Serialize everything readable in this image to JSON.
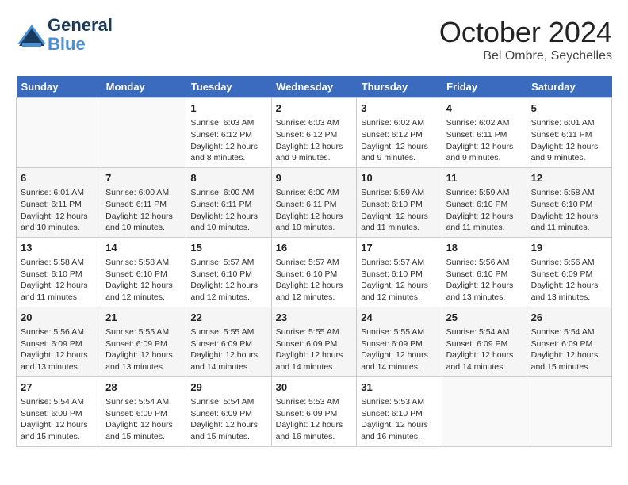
{
  "logo": {
    "line1": "General",
    "line2": "Blue"
  },
  "title": "October 2024",
  "location": "Bel Ombre, Seychelles",
  "days_of_week": [
    "Sunday",
    "Monday",
    "Tuesday",
    "Wednesday",
    "Thursday",
    "Friday",
    "Saturday"
  ],
  "weeks": [
    [
      {
        "day": "",
        "info": ""
      },
      {
        "day": "",
        "info": ""
      },
      {
        "day": "1",
        "info": "Sunrise: 6:03 AM\nSunset: 6:12 PM\nDaylight: 12 hours and 8 minutes."
      },
      {
        "day": "2",
        "info": "Sunrise: 6:03 AM\nSunset: 6:12 PM\nDaylight: 12 hours and 9 minutes."
      },
      {
        "day": "3",
        "info": "Sunrise: 6:02 AM\nSunset: 6:12 PM\nDaylight: 12 hours and 9 minutes."
      },
      {
        "day": "4",
        "info": "Sunrise: 6:02 AM\nSunset: 6:11 PM\nDaylight: 12 hours and 9 minutes."
      },
      {
        "day": "5",
        "info": "Sunrise: 6:01 AM\nSunset: 6:11 PM\nDaylight: 12 hours and 9 minutes."
      }
    ],
    [
      {
        "day": "6",
        "info": "Sunrise: 6:01 AM\nSunset: 6:11 PM\nDaylight: 12 hours and 10 minutes."
      },
      {
        "day": "7",
        "info": "Sunrise: 6:00 AM\nSunset: 6:11 PM\nDaylight: 12 hours and 10 minutes."
      },
      {
        "day": "8",
        "info": "Sunrise: 6:00 AM\nSunset: 6:11 PM\nDaylight: 12 hours and 10 minutes."
      },
      {
        "day": "9",
        "info": "Sunrise: 6:00 AM\nSunset: 6:11 PM\nDaylight: 12 hours and 10 minutes."
      },
      {
        "day": "10",
        "info": "Sunrise: 5:59 AM\nSunset: 6:10 PM\nDaylight: 12 hours and 11 minutes."
      },
      {
        "day": "11",
        "info": "Sunrise: 5:59 AM\nSunset: 6:10 PM\nDaylight: 12 hours and 11 minutes."
      },
      {
        "day": "12",
        "info": "Sunrise: 5:58 AM\nSunset: 6:10 PM\nDaylight: 12 hours and 11 minutes."
      }
    ],
    [
      {
        "day": "13",
        "info": "Sunrise: 5:58 AM\nSunset: 6:10 PM\nDaylight: 12 hours and 11 minutes."
      },
      {
        "day": "14",
        "info": "Sunrise: 5:58 AM\nSunset: 6:10 PM\nDaylight: 12 hours and 12 minutes."
      },
      {
        "day": "15",
        "info": "Sunrise: 5:57 AM\nSunset: 6:10 PM\nDaylight: 12 hours and 12 minutes."
      },
      {
        "day": "16",
        "info": "Sunrise: 5:57 AM\nSunset: 6:10 PM\nDaylight: 12 hours and 12 minutes."
      },
      {
        "day": "17",
        "info": "Sunrise: 5:57 AM\nSunset: 6:10 PM\nDaylight: 12 hours and 12 minutes."
      },
      {
        "day": "18",
        "info": "Sunrise: 5:56 AM\nSunset: 6:10 PM\nDaylight: 12 hours and 13 minutes."
      },
      {
        "day": "19",
        "info": "Sunrise: 5:56 AM\nSunset: 6:09 PM\nDaylight: 12 hours and 13 minutes."
      }
    ],
    [
      {
        "day": "20",
        "info": "Sunrise: 5:56 AM\nSunset: 6:09 PM\nDaylight: 12 hours and 13 minutes."
      },
      {
        "day": "21",
        "info": "Sunrise: 5:55 AM\nSunset: 6:09 PM\nDaylight: 12 hours and 13 minutes."
      },
      {
        "day": "22",
        "info": "Sunrise: 5:55 AM\nSunset: 6:09 PM\nDaylight: 12 hours and 14 minutes."
      },
      {
        "day": "23",
        "info": "Sunrise: 5:55 AM\nSunset: 6:09 PM\nDaylight: 12 hours and 14 minutes."
      },
      {
        "day": "24",
        "info": "Sunrise: 5:55 AM\nSunset: 6:09 PM\nDaylight: 12 hours and 14 minutes."
      },
      {
        "day": "25",
        "info": "Sunrise: 5:54 AM\nSunset: 6:09 PM\nDaylight: 12 hours and 14 minutes."
      },
      {
        "day": "26",
        "info": "Sunrise: 5:54 AM\nSunset: 6:09 PM\nDaylight: 12 hours and 15 minutes."
      }
    ],
    [
      {
        "day": "27",
        "info": "Sunrise: 5:54 AM\nSunset: 6:09 PM\nDaylight: 12 hours and 15 minutes."
      },
      {
        "day": "28",
        "info": "Sunrise: 5:54 AM\nSunset: 6:09 PM\nDaylight: 12 hours and 15 minutes."
      },
      {
        "day": "29",
        "info": "Sunrise: 5:54 AM\nSunset: 6:09 PM\nDaylight: 12 hours and 15 minutes."
      },
      {
        "day": "30",
        "info": "Sunrise: 5:53 AM\nSunset: 6:09 PM\nDaylight: 12 hours and 16 minutes."
      },
      {
        "day": "31",
        "info": "Sunrise: 5:53 AM\nSunset: 6:10 PM\nDaylight: 12 hours and 16 minutes."
      },
      {
        "day": "",
        "info": ""
      },
      {
        "day": "",
        "info": ""
      }
    ]
  ]
}
